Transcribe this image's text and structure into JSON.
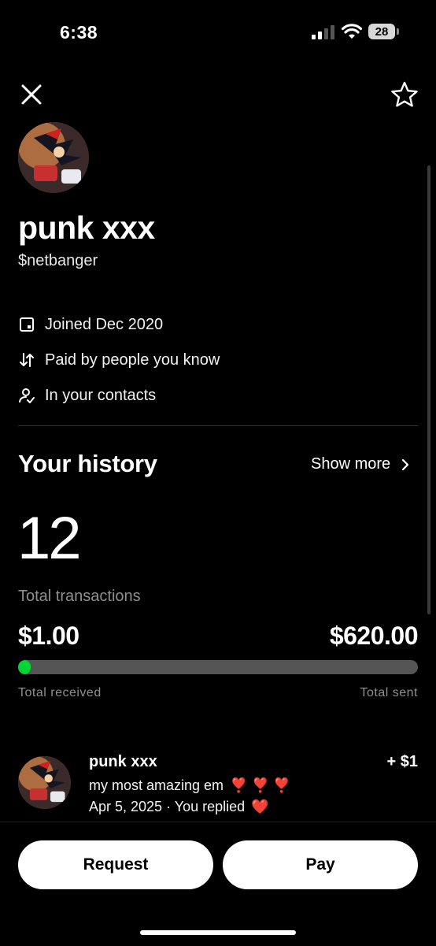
{
  "status_bar": {
    "time": "6:38",
    "battery_level": "28",
    "signal_icon": "cellular-signal-icon",
    "wifi_icon": "wifi-icon"
  },
  "nav": {
    "close_icon": "close-icon",
    "favorite_icon": "star-icon"
  },
  "profile": {
    "name": "punk xxx",
    "cashtag": "$netbanger",
    "info": [
      {
        "icon": "calendar-icon",
        "text": "Joined Dec 2020"
      },
      {
        "icon": "arrows-updown-icon",
        "text": "Paid by people you know"
      },
      {
        "icon": "contact-check-icon",
        "text": "In your contacts"
      }
    ]
  },
  "history": {
    "title": "Your history",
    "show_more": "Show more",
    "count": "12",
    "count_label": "Total transactions",
    "received": "$1.00",
    "sent": "$620.00",
    "received_fraction": 0.016,
    "received_label": "Total received",
    "sent_label": "Total sent",
    "accent_color": "#00d632"
  },
  "transaction": {
    "name": "punk xxx",
    "amount": "+ $1",
    "message": "my most amazing em",
    "message_emoji": "❣️ ❣️ ❣️",
    "date_text": "Apr 5, 2025 · You replied",
    "reply_emoji": "❤️"
  },
  "actions": {
    "request": "Request",
    "pay": "Pay"
  }
}
